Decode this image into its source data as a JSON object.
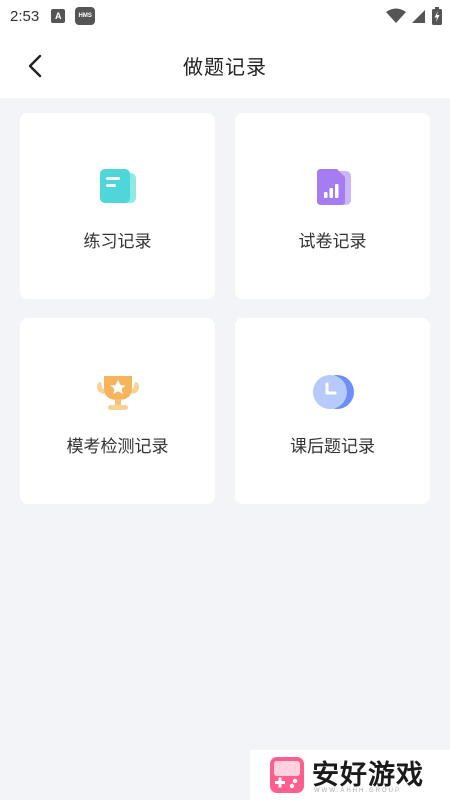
{
  "status_bar": {
    "time": "2:53",
    "app_icon_text": "A",
    "hms_text": "HMS"
  },
  "header": {
    "title": "做题记录",
    "back_icon": "chevron-left-icon"
  },
  "cards": [
    {
      "label": "练习记录",
      "icon": "practice-doc-icon",
      "color": "#4fd6d9"
    },
    {
      "label": "试卷记录",
      "icon": "exam-paper-chart-icon",
      "color": "#a67cf2"
    },
    {
      "label": "模考检测记录",
      "icon": "trophy-icon",
      "color": "#f6b45d"
    },
    {
      "label": "课后题记录",
      "icon": "clock-moon-icon",
      "color": "#6d8ef5"
    }
  ],
  "watermark": {
    "name": "安好游戏",
    "sub": "WWW.AHHH.GROUP"
  },
  "colors": {
    "background": "#f2f4f8",
    "card": "#ffffff",
    "title_text": "#222222"
  }
}
